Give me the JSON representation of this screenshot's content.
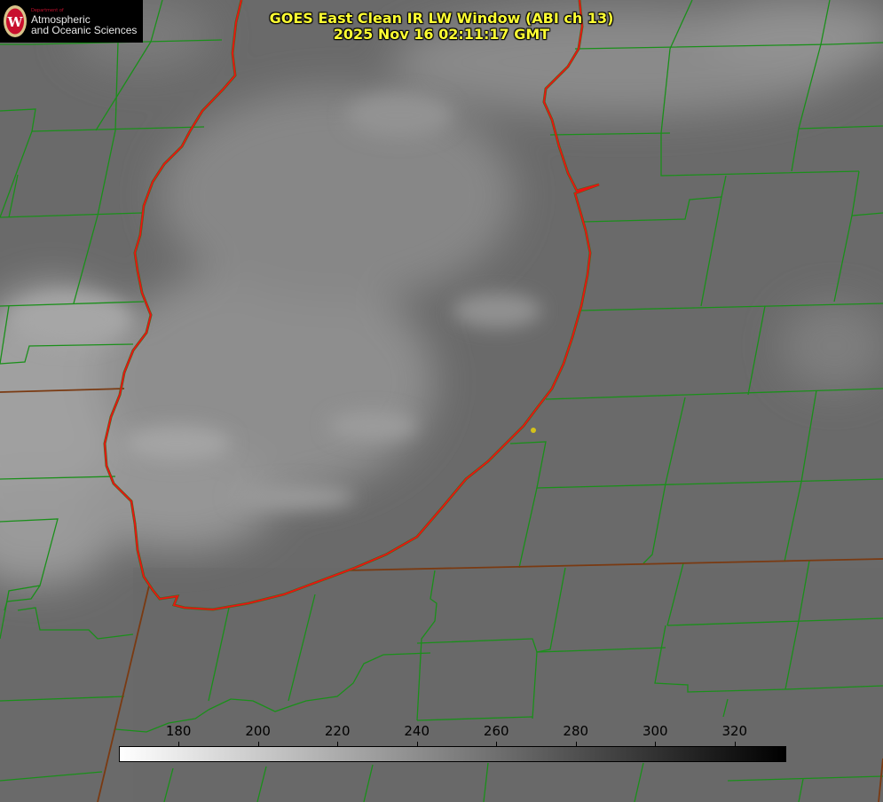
{
  "title": {
    "line1": "GOES East Clean IR LW Window (ABI ch 13)",
    "line2": "2025 Nov 16 02:11:17 GMT"
  },
  "logo": {
    "department": "Department of",
    "line1": "Atmospheric",
    "line2": "and Oceanic Sciences",
    "icon": "uw-crest-icon"
  },
  "colorbar": {
    "min": 165,
    "max": 333,
    "gradient_from": "#ffffff",
    "gradient_to": "#000000",
    "ticks": [
      {
        "value": 180,
        "label": "180"
      },
      {
        "value": 200,
        "label": "200"
      },
      {
        "value": 220,
        "label": "220"
      },
      {
        "value": 240,
        "label": "240"
      },
      {
        "value": 260,
        "label": "260"
      },
      {
        "value": 280,
        "label": "280"
      },
      {
        "value": 300,
        "label": "300"
      },
      {
        "value": 320,
        "label": "320"
      }
    ]
  },
  "colors": {
    "county_lines": "#1a8f1a",
    "state_lines": "#7a3a12",
    "coastline": "#ee1111",
    "title_text": "#ffff33",
    "marker": "#d4c21a"
  }
}
